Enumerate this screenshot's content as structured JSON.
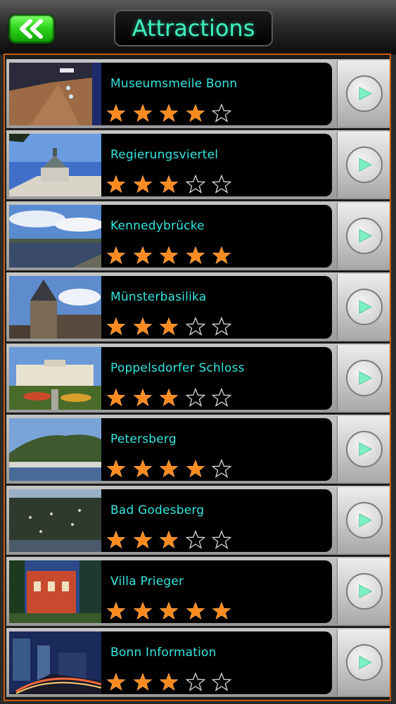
{
  "header": {
    "title": "Attractions",
    "back_icon": "double-chevron-left-icon"
  },
  "colors": {
    "accent_green": "#2fd61b",
    "title_cyan": "#3ef0bf",
    "item_text": "#33e6e1",
    "star_filled": "#ff8a1f",
    "list_border": "#c85a14"
  },
  "items": [
    {
      "name": "Museumsmeile Bonn",
      "rating": 4,
      "max_rating": 5
    },
    {
      "name": "Regierungsviertel",
      "rating": 3,
      "max_rating": 5
    },
    {
      "name": "Kennedybrücke",
      "rating": 5,
      "max_rating": 5
    },
    {
      "name": "Münsterbasilika",
      "rating": 3,
      "max_rating": 5
    },
    {
      "name": "Poppelsdorfer Schloss",
      "rating": 3,
      "max_rating": 5
    },
    {
      "name": "Petersberg",
      "rating": 4,
      "max_rating": 5
    },
    {
      "name": "Bad Godesberg",
      "rating": 3,
      "max_rating": 5
    },
    {
      "name": "Villa Prieger",
      "rating": 5,
      "max_rating": 5
    },
    {
      "name": "Bonn Information",
      "rating": 3,
      "max_rating": 5
    }
  ]
}
